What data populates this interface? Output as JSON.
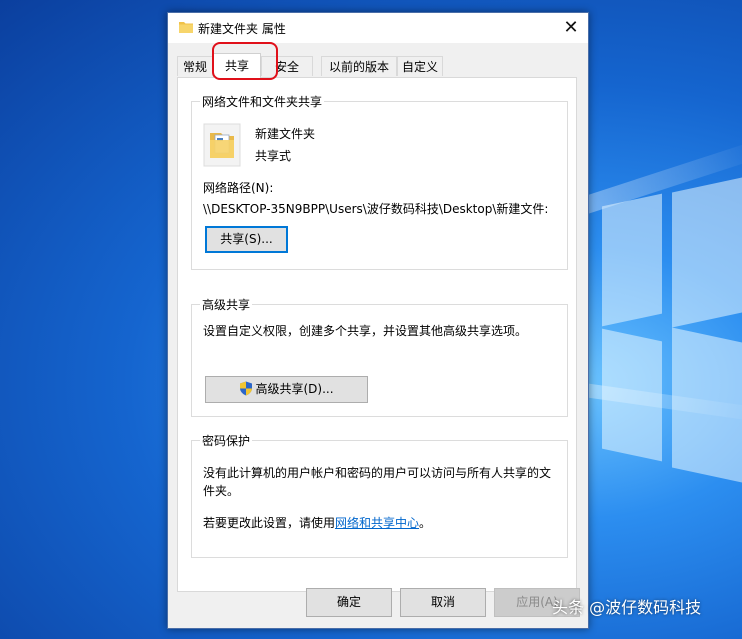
{
  "window": {
    "title": "新建文件夹 属性",
    "close_symbol": "✕"
  },
  "tabs": [
    {
      "label": "常规"
    },
    {
      "label": "共享"
    },
    {
      "label": "安全"
    },
    {
      "label": "以前的版本"
    },
    {
      "label": "自定义"
    }
  ],
  "network_sharing": {
    "group_title": "网络文件和文件夹共享",
    "folder_name": "新建文件夹",
    "folder_status": "共享式",
    "path_label": "网络路径(N):",
    "path_value": "\\\\DESKTOP-35N9BPP\\Users\\波仔数码科技\\Desktop\\新建文件:",
    "share_button": "共享(S)..."
  },
  "advanced_sharing": {
    "group_title": "高级共享",
    "description": "设置自定义权限，创建多个共享，并设置其他高级共享选项。",
    "button": "高级共享(D)..."
  },
  "password_protection": {
    "group_title": "密码保护",
    "description": "没有此计算机的用户帐户和密码的用户可以访问与所有人共享的文件夹。",
    "change_prefix": "若要更改此设置，请使用",
    "link_text": "网络和共享中心",
    "change_suffix": "。"
  },
  "footer": {
    "ok": "确定",
    "cancel": "取消",
    "apply": "应用(A)"
  },
  "watermark": "头条 @波仔数码科技",
  "colors": {
    "accent": "#0078d7",
    "highlight_circle": "#e0101a",
    "link": "#0066cc"
  }
}
